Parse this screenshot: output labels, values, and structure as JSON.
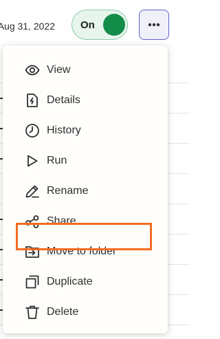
{
  "row": {
    "date": "Aug 31, 2022",
    "toggle_label": "On",
    "more_label": "More actions"
  },
  "colors": {
    "toggle_knob": "#148c4a",
    "more_button_border": "#5b5fc7",
    "highlight": "#f36b21"
  },
  "menu": {
    "items": [
      {
        "label": "View",
        "icon": "eye-icon"
      },
      {
        "label": "Details",
        "icon": "document-bolt-icon"
      },
      {
        "label": "History",
        "icon": "clock-icon"
      },
      {
        "label": "Run",
        "icon": "play-icon"
      },
      {
        "label": "Rename",
        "icon": "pencil-icon",
        "highlighted": true
      },
      {
        "label": "Share",
        "icon": "share-icon"
      },
      {
        "label": "Move to folder",
        "icon": "folder-arrow-icon"
      },
      {
        "label": "Duplicate",
        "icon": "duplicate-icon"
      },
      {
        "label": "Delete",
        "icon": "trash-icon"
      }
    ]
  }
}
